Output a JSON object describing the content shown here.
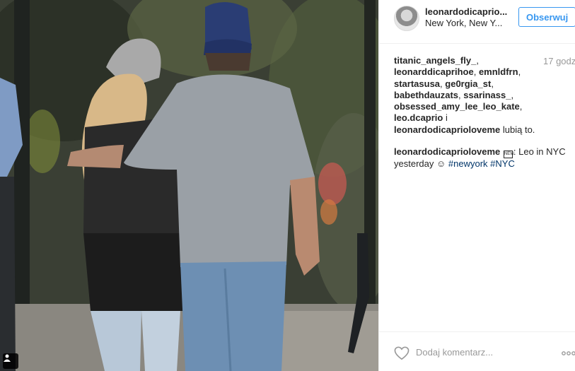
{
  "post": {
    "username": "leonardodicaprio...",
    "location": "New York, New Y...",
    "follow_label": "Obserwuj",
    "time": "17 godz",
    "likes": {
      "users": [
        "titanic_angels_fly_",
        "leonarddicaprihoe",
        "emnldfrn",
        "startasusa",
        "ge0rgia_st",
        "babethdauzats",
        "ssarinass_",
        "obsessed_amy_lee_leo_kate",
        "leo.dcaprio",
        "leonardodicaprioloveme"
      ],
      "conjunction": "i",
      "suffix": "lubią to."
    },
    "caption": {
      "author": "leonardodicaprioloveme",
      "glyph": "NEW",
      "text_before": ": Leo in NYC yesterday",
      "emoji": "☺",
      "hashtags": [
        "#newyork",
        "#NYC"
      ]
    },
    "comment_placeholder": "Dodaj komentarz...",
    "icons": {
      "like": "heart-icon",
      "more": "more-options-icon",
      "photo_badge": "person-tag-icon"
    },
    "colors": {
      "accent": "#3897f0",
      "hashtag": "#003569",
      "muted": "#999999"
    }
  }
}
